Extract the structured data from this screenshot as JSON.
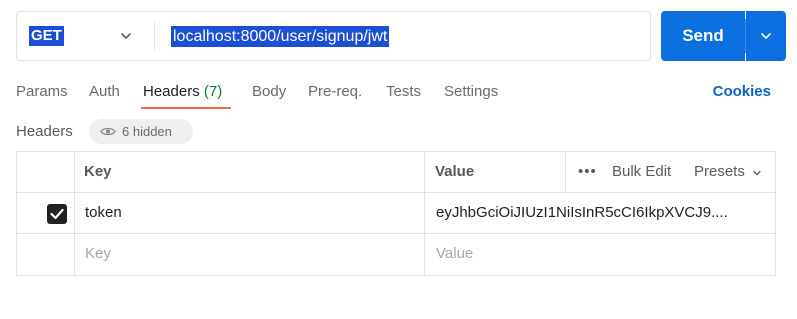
{
  "request": {
    "method": "GET",
    "url": "localhost:8000/user/signup/jwt",
    "send_label": "Send"
  },
  "tabs": [
    {
      "label": "Params"
    },
    {
      "label": "Auth"
    },
    {
      "label": "Headers",
      "count": "(7)",
      "active": true
    },
    {
      "label": "Body"
    },
    {
      "label": "Pre-req."
    },
    {
      "label": "Tests"
    },
    {
      "label": "Settings"
    }
  ],
  "cookies_label": "Cookies",
  "headers_section": {
    "label": "Headers",
    "hidden_label": "6 hidden"
  },
  "table": {
    "columns": {
      "key": "Key",
      "value": "Value"
    },
    "actions": {
      "more": "•••",
      "bulk_edit": "Bulk Edit",
      "presets": "Presets"
    },
    "rows": [
      {
        "checked": true,
        "key": "token",
        "value": "eyJhbGciOiJIUzI1NiIsInR5cCI6IkpXVCJ9...."
      }
    ],
    "new_row": {
      "key_placeholder": "Key",
      "value_placeholder": "Value"
    }
  },
  "colors": {
    "send_button": "#0b6fdf",
    "selection": "#1a4fd6",
    "active_tab_underline": "#f26b3a",
    "count": "#0a7d2c",
    "cookies": "#0b63c9"
  },
  "icons": {
    "method_dropdown": "chevron-down-icon",
    "send_dropdown": "chevron-down-icon",
    "hidden_toggle": "eye-icon",
    "row_checkbox": "check-icon",
    "presets_dropdown": "chevron-down-icon"
  }
}
